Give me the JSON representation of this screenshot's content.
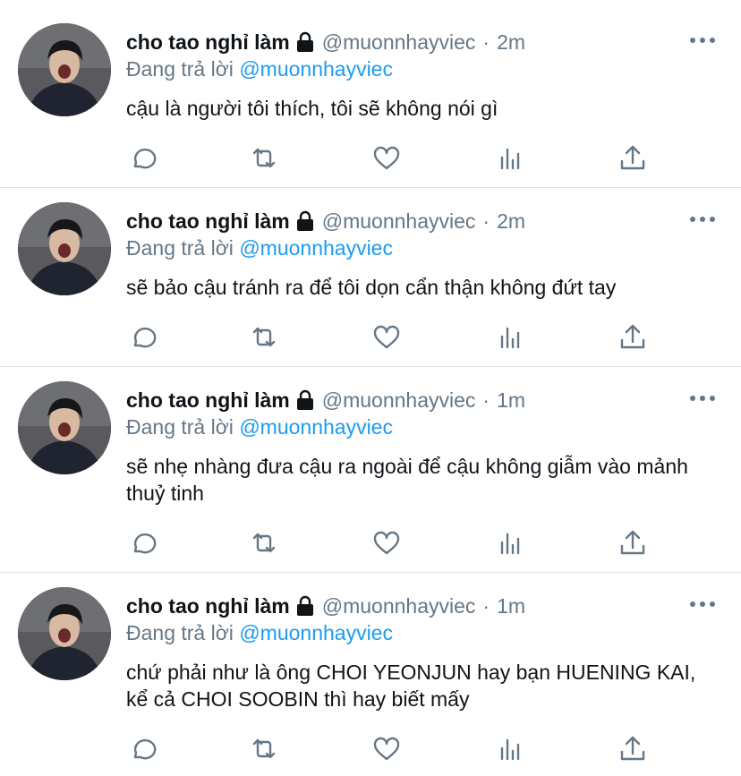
{
  "tweets": [
    {
      "name": "cho tao nghỉ làm",
      "handle": "@muonnhayviec",
      "time": "2m",
      "reply_prefix": "Đang trả lời",
      "reply_to": "@muonnhayviec",
      "text": "cậu là người tôi thích, tôi sẽ không nói gì"
    },
    {
      "name": "cho tao nghỉ làm",
      "handle": "@muonnhayviec",
      "time": "2m",
      "reply_prefix": "Đang trả lời",
      "reply_to": "@muonnhayviec",
      "text": "sẽ bảo cậu tránh ra để tôi dọn cẩn thận không đứt tay"
    },
    {
      "name": "cho tao nghỉ làm",
      "handle": "@muonnhayviec",
      "time": "1m",
      "reply_prefix": "Đang trả lời",
      "reply_to": "@muonnhayviec",
      "text": "sẽ nhẹ nhàng đưa cậu ra ngoài để cậu không giẫm vào mảnh thuỷ tinh"
    },
    {
      "name": "cho tao nghỉ làm",
      "handle": "@muonnhayviec",
      "time": "1m",
      "reply_prefix": "Đang trả lời",
      "reply_to": "@muonnhayviec",
      "text": "chứ phải như là ông CHOI YEONJUN hay bạn HUENING KAI, kể cả CHOI SOOBIN thì hay biết mấy"
    }
  ],
  "icons": {
    "lock": "lock-icon",
    "more": "more-icon",
    "reply": "reply-icon",
    "retweet": "retweet-icon",
    "like": "like-icon",
    "analytics": "analytics-icon",
    "share": "share-icon"
  },
  "colors": {
    "text": "#0f1419",
    "secondary": "#657786",
    "link": "#1d9bf0",
    "divider": "#e1e4e8"
  },
  "separator": "·"
}
